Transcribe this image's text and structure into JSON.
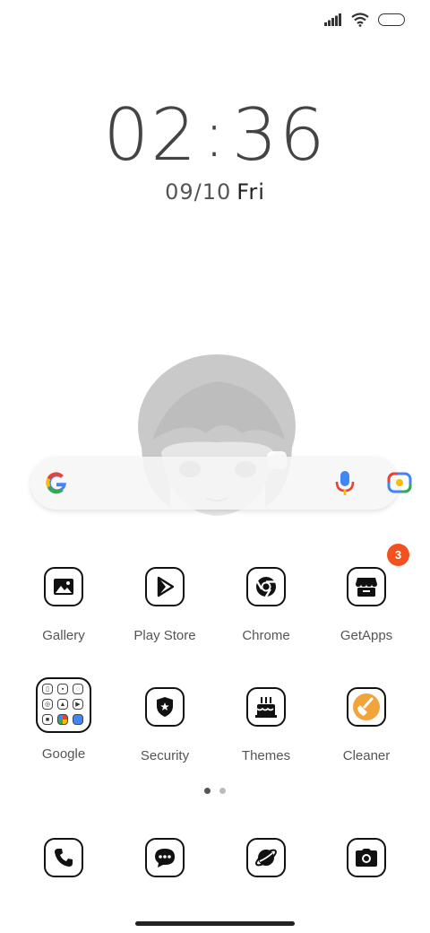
{
  "status_bar": {
    "signal": "signal-icon",
    "wifi": "wifi-icon",
    "battery": "battery-icon"
  },
  "clock": {
    "hours": "02",
    "minutes": "36"
  },
  "date": {
    "date": "09/10",
    "day": "Fri"
  },
  "search_bar": {
    "logo": "google-logo-icon",
    "mic": "microphone-icon",
    "lens": "google-lens-icon"
  },
  "apps_row1": [
    {
      "label": "Gallery",
      "icon": "gallery-icon"
    },
    {
      "label": "Play Store",
      "icon": "play-store-icon"
    },
    {
      "label": "Chrome",
      "icon": "chrome-icon"
    },
    {
      "label": "GetApps",
      "icon": "getapps-icon",
      "badge": "3"
    }
  ],
  "apps_row2": [
    {
      "label": "Google",
      "icon": "google-folder"
    },
    {
      "label": "Security",
      "icon": "security-shield-icon"
    },
    {
      "label": "Themes",
      "icon": "themes-cake-icon"
    },
    {
      "label": "Cleaner",
      "icon": "cleaner-broom-icon"
    }
  ],
  "dock": [
    {
      "icon": "phone-icon"
    },
    {
      "icon": "messages-icon"
    },
    {
      "icon": "browser-planet-icon"
    },
    {
      "icon": "camera-icon"
    }
  ],
  "page_indicator": {
    "pages": 2,
    "current": 1
  },
  "colors": {
    "badge": "#f4511e",
    "cleaner": "#f2a33a"
  }
}
